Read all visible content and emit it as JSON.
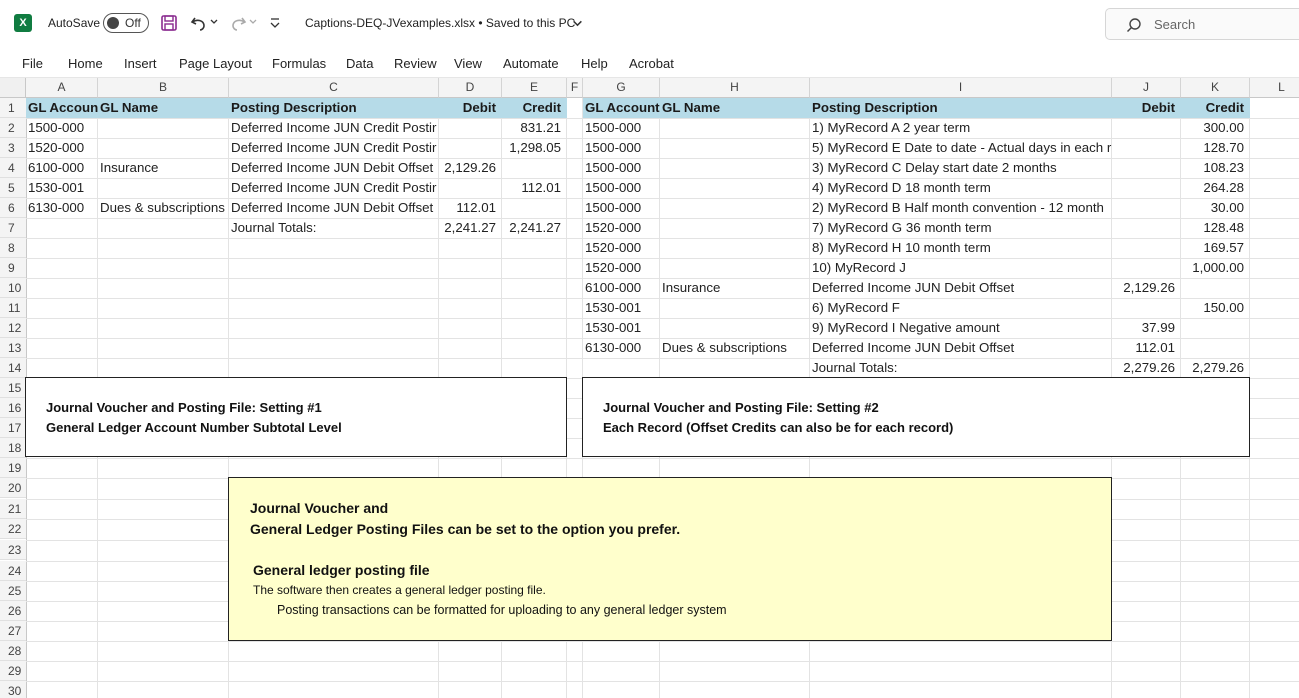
{
  "titlebar": {
    "app_logo": "X",
    "autosave_label": "AutoSave",
    "autosave_state": "Off",
    "filename": "Captions-DEQ-JVexamples.xlsx • Saved to this PC",
    "search_placeholder": "Search",
    "icons": [
      "excel-icon",
      "save-icon",
      "undo-icon",
      "redo-icon",
      "customize-icon",
      "chevron-down-icon",
      "search-icon"
    ]
  },
  "ribbon": {
    "tabs": [
      "File",
      "Home",
      "Insert",
      "Page Layout",
      "Formulas",
      "Data",
      "Review",
      "View",
      "Automate",
      "Help",
      "Acrobat"
    ]
  },
  "columns": [
    "A",
    "B",
    "C",
    "D",
    "E",
    "F",
    "G",
    "H",
    "I",
    "J",
    "K",
    "L"
  ],
  "rows": [
    "1",
    "2",
    "3",
    "4",
    "5",
    "6",
    "7",
    "8",
    "9",
    "10",
    "11",
    "12",
    "13",
    "14",
    "15",
    "16",
    "17",
    "18",
    "19",
    "20",
    "21",
    "22",
    "23",
    "24",
    "25",
    "26",
    "27",
    "28",
    "29",
    "30"
  ],
  "colors": {
    "header_band": "#b6dbe8",
    "note_fill": "#ffffcc",
    "excel_green": "#107c41"
  },
  "left_table": {
    "headers": [
      "GL Account",
      "GL Name",
      "Posting Description",
      "Debit",
      "Credit"
    ],
    "rows": [
      [
        "1500-000",
        "",
        "Deferred Income JUN Credit Postir",
        "",
        "831.21"
      ],
      [
        "1520-000",
        "",
        "Deferred Income JUN Credit Postir",
        "",
        "1,298.05"
      ],
      [
        "6100-000",
        "Insurance",
        "Deferred Income JUN Debit Offset",
        "2,129.26",
        ""
      ],
      [
        "1530-001",
        "",
        "Deferred Income JUN Credit Postir",
        "",
        "112.01"
      ],
      [
        "6130-000",
        "Dues & subscriptions",
        "Deferred Income JUN Debit Offset",
        "112.01",
        ""
      ],
      [
        "",
        "",
        "Journal Totals:",
        "2,241.27",
        "2,241.27"
      ]
    ]
  },
  "right_table": {
    "headers": [
      "GL Account",
      "GL Name",
      "Posting Description",
      "Debit",
      "Credit"
    ],
    "rows": [
      [
        "1500-000",
        "",
        "1) MyRecord A 2 year term",
        "",
        "300.00"
      ],
      [
        "1500-000",
        "",
        "5) MyRecord E Date to date - Actual days in each r",
        "",
        "128.70"
      ],
      [
        "1500-000",
        "",
        "3) MyRecord C Delay start date 2 months",
        "",
        "108.23"
      ],
      [
        "1500-000",
        "",
        "4) MyRecord D 18 month term",
        "",
        "264.28"
      ],
      [
        "1500-000",
        "",
        "2) MyRecord B Half month convention - 12 month",
        "",
        "30.00"
      ],
      [
        "1520-000",
        "",
        "7) MyRecord G 36 month term",
        "",
        "128.48"
      ],
      [
        "1520-000",
        "",
        "8) MyRecord H 10 month term",
        "",
        "169.57"
      ],
      [
        "1520-000",
        "",
        "10) MyRecord J",
        "",
        "1,000.00"
      ],
      [
        "6100-000",
        "Insurance",
        "Deferred Income JUN Debit Offset",
        "2,129.26",
        ""
      ],
      [
        "1530-001",
        "",
        "6) MyRecord F",
        "",
        "150.00"
      ],
      [
        "1530-001",
        "",
        "9) MyRecord I Negative amount",
        "37.99",
        ""
      ],
      [
        "6130-000",
        "Dues & subscriptions",
        "Deferred Income JUN Debit Offset",
        "112.01",
        ""
      ],
      [
        "",
        "",
        "Journal Totals:",
        "2,279.26",
        "2,279.26"
      ]
    ]
  },
  "setting1": {
    "line1": "Journal Voucher and Posting File:  Setting #1",
    "line2": "General Ledger Account Number Subtotal Level"
  },
  "setting2": {
    "line1": "Journal Voucher and Posting File:  Setting #2",
    "line2": "Each Record  (Offset Credits can also be for each record)"
  },
  "note": {
    "line1": "Journal Voucher and",
    "line2": "General Ledger Posting Files can be set to the option you prefer.",
    "line3": "General ledger posting file",
    "line4": "The software then creates a general ledger posting file.",
    "line5": "Posting transactions can be formatted for uploading to any general ledger system"
  }
}
